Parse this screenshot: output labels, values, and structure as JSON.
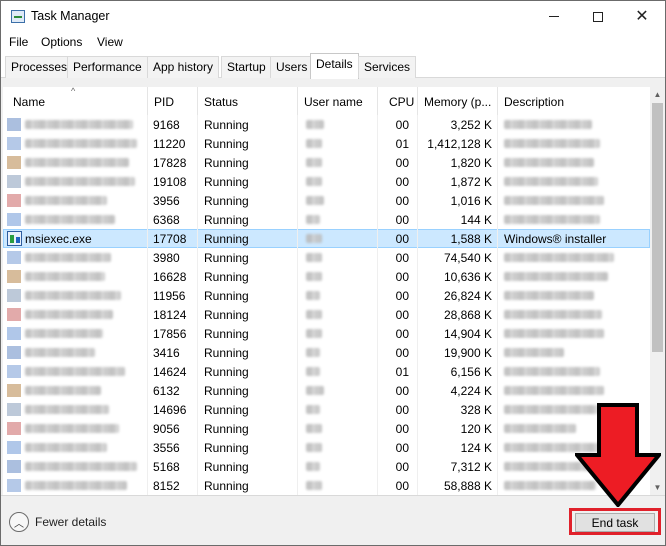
{
  "window": {
    "title": "Task Manager",
    "controls": {
      "minimize": "minimize-icon",
      "maximize": "maximize-icon",
      "close": "close-icon"
    }
  },
  "menu": [
    "File",
    "Options",
    "View"
  ],
  "tabs": [
    {
      "label": "Processes",
      "active": false
    },
    {
      "label": "Performance",
      "active": false
    },
    {
      "label": "App history",
      "active": false
    },
    {
      "label": "Startup",
      "active": false
    },
    {
      "label": "Users",
      "active": false
    },
    {
      "label": "Details",
      "active": true
    },
    {
      "label": "Services",
      "active": false
    }
  ],
  "table": {
    "columns": {
      "name": "Name",
      "pid": "PID",
      "status": "Status",
      "user": "User name",
      "cpu": "CPU",
      "memory": "Memory (p...",
      "description": "Description"
    },
    "rows": [
      {
        "name": "",
        "pid": "9168",
        "status": "Running",
        "cpu": "00",
        "memory": "3,252 K",
        "description": "",
        "selected": false
      },
      {
        "name": "",
        "pid": "11220",
        "status": "Running",
        "cpu": "01",
        "memory": "1,412,128 K",
        "description": "",
        "selected": false
      },
      {
        "name": "",
        "pid": "17828",
        "status": "Running",
        "cpu": "00",
        "memory": "1,820 K",
        "description": "",
        "selected": false
      },
      {
        "name": "",
        "pid": "19108",
        "status": "Running",
        "cpu": "00",
        "memory": "1,872 K",
        "description": "",
        "selected": false
      },
      {
        "name": "",
        "pid": "3956",
        "status": "Running",
        "cpu": "00",
        "memory": "1,016 K",
        "description": "",
        "selected": false
      },
      {
        "name": "",
        "pid": "6368",
        "status": "Running",
        "cpu": "00",
        "memory": "144 K",
        "description": "",
        "selected": false
      },
      {
        "name": "msiexec.exe",
        "pid": "17708",
        "status": "Running",
        "cpu": "00",
        "memory": "1,588 K",
        "description": "Windows® installer",
        "selected": true
      },
      {
        "name": "",
        "pid": "3980",
        "status": "Running",
        "cpu": "00",
        "memory": "74,540 K",
        "description": "",
        "selected": false
      },
      {
        "name": "",
        "pid": "16628",
        "status": "Running",
        "cpu": "00",
        "memory": "10,636 K",
        "description": "",
        "selected": false
      },
      {
        "name": "",
        "pid": "11956",
        "status": "Running",
        "cpu": "00",
        "memory": "26,824 K",
        "description": "",
        "selected": false
      },
      {
        "name": "",
        "pid": "18124",
        "status": "Running",
        "cpu": "00",
        "memory": "28,868 K",
        "description": "",
        "selected": false
      },
      {
        "name": "",
        "pid": "17856",
        "status": "Running",
        "cpu": "00",
        "memory": "14,904 K",
        "description": "",
        "selected": false
      },
      {
        "name": "",
        "pid": "3416",
        "status": "Running",
        "cpu": "00",
        "memory": "19,900 K",
        "description": "",
        "selected": false
      },
      {
        "name": "",
        "pid": "14624",
        "status": "Running",
        "cpu": "01",
        "memory": "6,156 K",
        "description": "",
        "selected": false
      },
      {
        "name": "",
        "pid": "6132",
        "status": "Running",
        "cpu": "00",
        "memory": "4,224 K",
        "description": "",
        "selected": false
      },
      {
        "name": "",
        "pid": "14696",
        "status": "Running",
        "cpu": "00",
        "memory": "328 K",
        "description": "",
        "selected": false
      },
      {
        "name": "",
        "pid": "9056",
        "status": "Running",
        "cpu": "00",
        "memory": "120 K",
        "description": "",
        "selected": false
      },
      {
        "name": "",
        "pid": "3556",
        "status": "Running",
        "cpu": "00",
        "memory": "124 K",
        "description": "",
        "selected": false
      },
      {
        "name": "",
        "pid": "5168",
        "status": "Running",
        "cpu": "00",
        "memory": "7,312 K",
        "description": "",
        "selected": false
      },
      {
        "name": "",
        "pid": "8152",
        "status": "Running",
        "cpu": "00",
        "memory": "58,888 K",
        "description": "",
        "selected": false
      }
    ]
  },
  "footer": {
    "fewer_details": "Fewer details",
    "end_task": "End task"
  },
  "colors": {
    "selection": "#cce8ff",
    "annotation": "#e0212b"
  }
}
